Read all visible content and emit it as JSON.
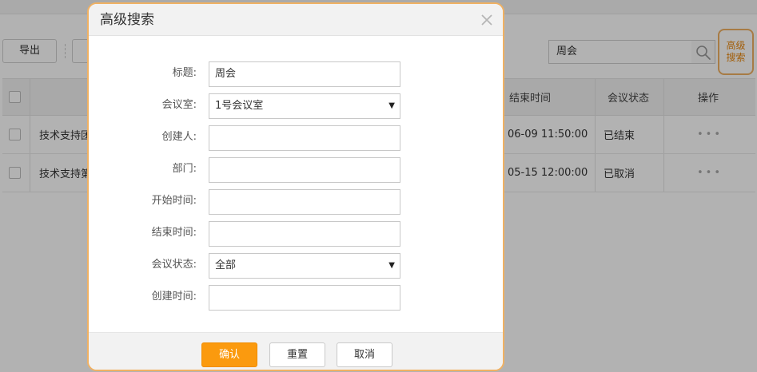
{
  "background": {
    "toolbar": {
      "export_label": "导出",
      "search_value": "周会",
      "advanced_search_line1": "高级",
      "advanced_search_line2": "搜索"
    },
    "table": {
      "headers": {
        "end_time": "结束时间",
        "status": "会议状态",
        "actions": "操作"
      },
      "rows": [
        {
          "title_visible": "技术支持团",
          "end_time_visible": "06-09 11:50:00",
          "status": "已结束",
          "actions": "•••"
        },
        {
          "title_visible": "技术支持第",
          "end_time_visible": "05-15 12:00:00",
          "status": "已取消",
          "actions": "•••"
        }
      ]
    }
  },
  "modal": {
    "title": "高级搜索",
    "fields": [
      {
        "label": "标题:",
        "value": "周会",
        "type": "text"
      },
      {
        "label": "会议室:",
        "value": "1号会议室",
        "type": "select"
      },
      {
        "label": "创建人:",
        "value": "",
        "type": "text"
      },
      {
        "label": "部门:",
        "value": "",
        "type": "text"
      },
      {
        "label": "开始时间:",
        "value": "",
        "type": "text"
      },
      {
        "label": "结束时间:",
        "value": "",
        "type": "text"
      },
      {
        "label": "会议状态:",
        "value": "全部",
        "type": "select"
      },
      {
        "label": "创建时间:",
        "value": "",
        "type": "text"
      }
    ],
    "buttons": {
      "confirm": "确认",
      "reset": "重置",
      "cancel": "取消"
    }
  },
  "colors": {
    "accent": "#fb9a0e",
    "highlight_border": "#f0b163",
    "advanced_text": "#e8870e"
  }
}
